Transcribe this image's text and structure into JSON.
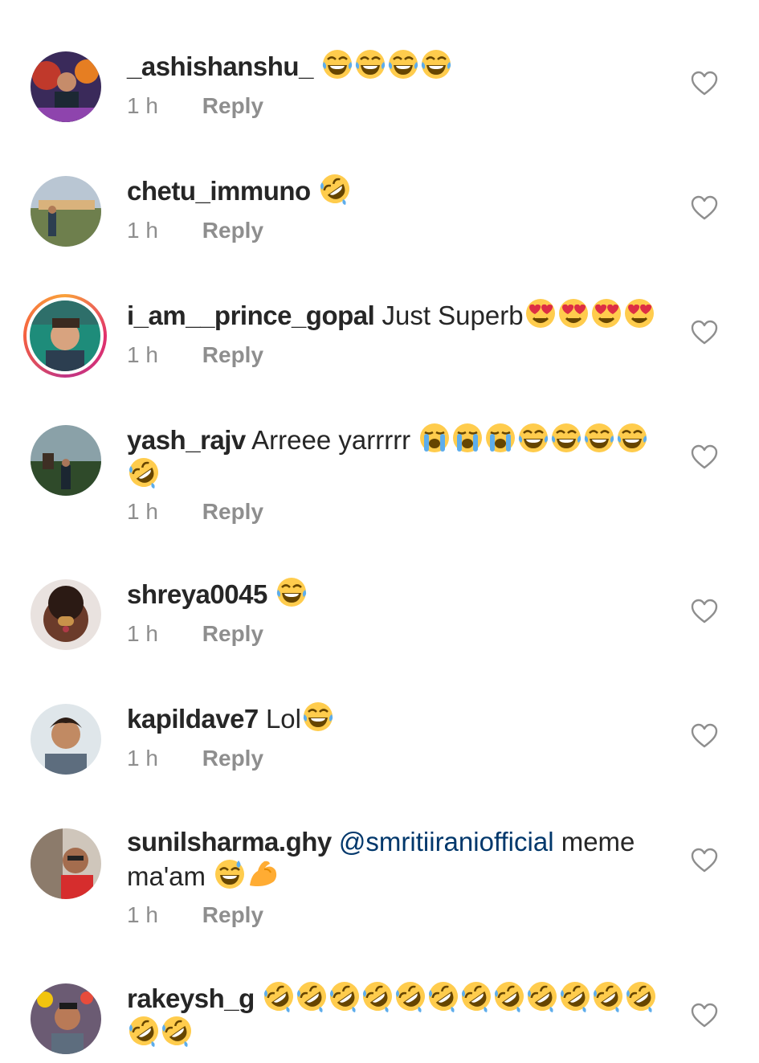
{
  "reply_label": "Reply",
  "comments": [
    {
      "username": "_ashishanshu_",
      "text": "",
      "emoji": [
        "joy",
        "joy",
        "joy",
        "joy"
      ],
      "time": "1 h",
      "avatar": "avatar-photo"
    },
    {
      "username": "chetu_immuno",
      "text": "",
      "emoji": [
        "rofl"
      ],
      "time": "1 h",
      "avatar": "avatar-photo"
    },
    {
      "username": "i_am__prince_gopal",
      "text": "Just Superb",
      "emoji": [
        "heart-eyes",
        "heart-eyes",
        "heart-eyes",
        "heart-eyes"
      ],
      "time": "1 h",
      "avatar": "avatar-photo-with-story-ring"
    },
    {
      "username": "yash_rajv",
      "text": "Arreee yarrrrr",
      "emoji": [
        "sob",
        "sob",
        "sob",
        "joy",
        "joy",
        "joy",
        "joy",
        "rofl"
      ],
      "time": "1 h",
      "avatar": "avatar-photo"
    },
    {
      "username": "shreya0045",
      "text": "",
      "emoji": [
        "joy"
      ],
      "time": "1 h",
      "avatar": "avatar-photo"
    },
    {
      "username": "kapildave7",
      "text": "Lol",
      "emoji": [
        "joy"
      ],
      "time": "1 h",
      "avatar": "avatar-photo"
    },
    {
      "username": "sunilsharma.ghy",
      "mention": "@smritiiraniofficial",
      "text": "meme ma'am",
      "emoji": [
        "sweat-smile",
        "flexed-biceps"
      ],
      "time": "1 h",
      "avatar": "avatar-photo"
    },
    {
      "username": "rakeysh_g",
      "text": "",
      "emoji": [
        "rofl",
        "rofl",
        "rofl",
        "rofl",
        "rofl",
        "rofl",
        "rofl",
        "rofl",
        "rofl",
        "rofl",
        "rofl",
        "rofl",
        "rofl",
        "rofl"
      ],
      "time": "",
      "avatar": "avatar-photo"
    }
  ],
  "colors": {
    "username": "#262626",
    "meta": "#8e8e8e",
    "mention": "#00376b",
    "heart_outline": "#8e8e8e",
    "story_ring": "#e1306c"
  }
}
